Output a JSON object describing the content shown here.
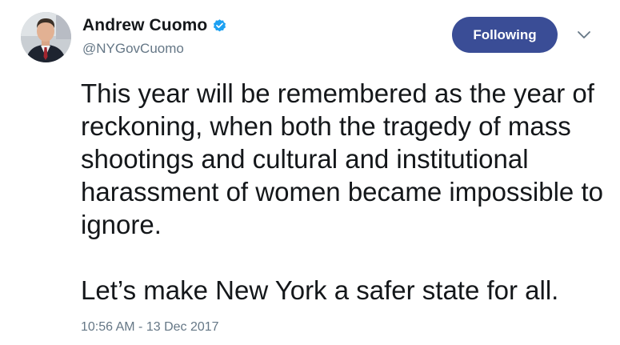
{
  "tweet": {
    "author": {
      "display_name": "Andrew Cuomo",
      "handle": "@NYGovCuomo",
      "verified_icon": "verified-badge-icon"
    },
    "follow_button_label": "Following",
    "menu_icon": "chevron-down-icon",
    "text_paragraphs": [
      "This year will be remembered as the year of reckoning, when both the tragedy of mass shootings and cultural and institutional harassment of women became impossible to ignore.",
      "Let’s make New York a safer state for all."
    ],
    "timestamp": "10:56 AM - 13 Dec 2017"
  },
  "colors": {
    "follow_button_bg": "#3a4d96",
    "verified_blue": "#1da1f2",
    "secondary_text": "#657786",
    "primary_text": "#14171a"
  }
}
